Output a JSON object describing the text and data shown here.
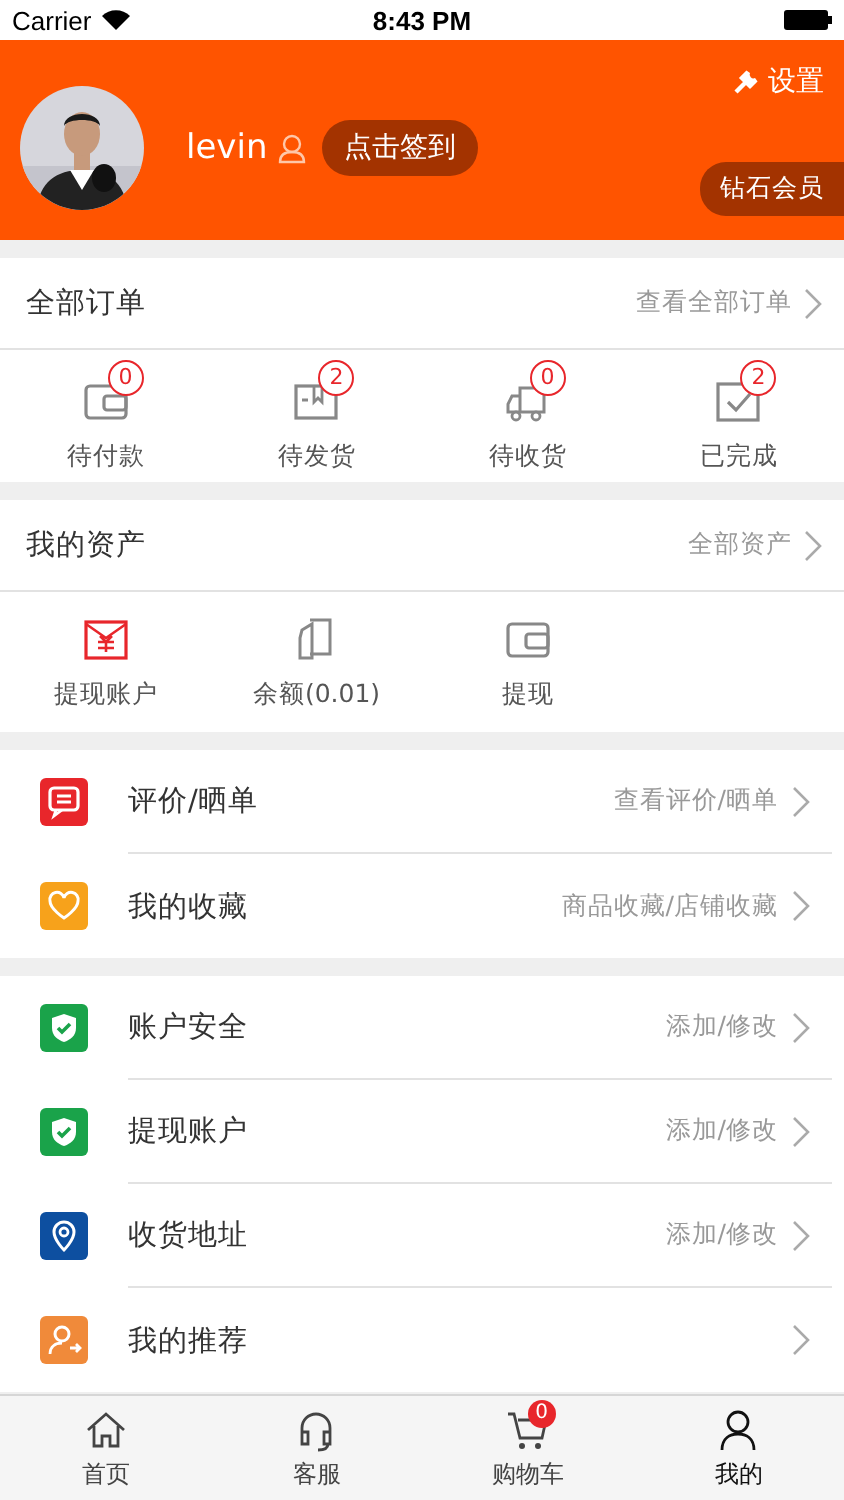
{
  "status_bar": {
    "carrier": "Carrier",
    "time": "8:43 PM"
  },
  "profile": {
    "settings": "设置",
    "username": "levin",
    "checkin": "点击签到",
    "member": "钻石会员"
  },
  "orders": {
    "title": "全部订单",
    "link": "查看全部订单",
    "items": [
      {
        "kind": "wallet",
        "label": "待付款",
        "count": "0"
      },
      {
        "kind": "box",
        "label": "待发货",
        "count": "2"
      },
      {
        "kind": "truck",
        "label": "待收货",
        "count": "0"
      },
      {
        "kind": "check",
        "label": "已完成",
        "count": "2"
      }
    ]
  },
  "assets": {
    "title": "我的资产",
    "link": "全部资产",
    "items": [
      {
        "kind": "envelope",
        "label": "提现账户"
      },
      {
        "kind": "cards",
        "label": "余额(0.01)"
      },
      {
        "kind": "wallet",
        "label": "提现"
      }
    ]
  },
  "menu_groups": [
    [
      {
        "kind": "comment",
        "label": "评价/晒单",
        "detail": "查看评价/晒单",
        "color": "#e8262b"
      },
      {
        "kind": "heart",
        "label": "我的收藏",
        "detail": "商品收藏/店铺收藏",
        "color": "#f7a21b"
      }
    ],
    [
      {
        "kind": "shield",
        "label": "账户安全",
        "detail": "添加/修改",
        "color": "#1aa34a"
      },
      {
        "kind": "shield",
        "label": "提现账户",
        "detail": "添加/修改",
        "color": "#1aa34a"
      },
      {
        "kind": "pin",
        "label": "收货地址",
        "detail": "添加/修改",
        "color": "#0d4fa0"
      },
      {
        "kind": "person",
        "label": "我的推荐",
        "color": "#f08a3a"
      }
    ]
  ],
  "tab_bar": [
    {
      "kind": "home",
      "label": "首页",
      "selected": false
    },
    {
      "kind": "headset",
      "label": "客服",
      "selected": false
    },
    {
      "kind": "cart",
      "label": "购物车",
      "selected": false,
      "badge": "0"
    },
    {
      "kind": "person",
      "label": "我的",
      "selected": true
    }
  ]
}
